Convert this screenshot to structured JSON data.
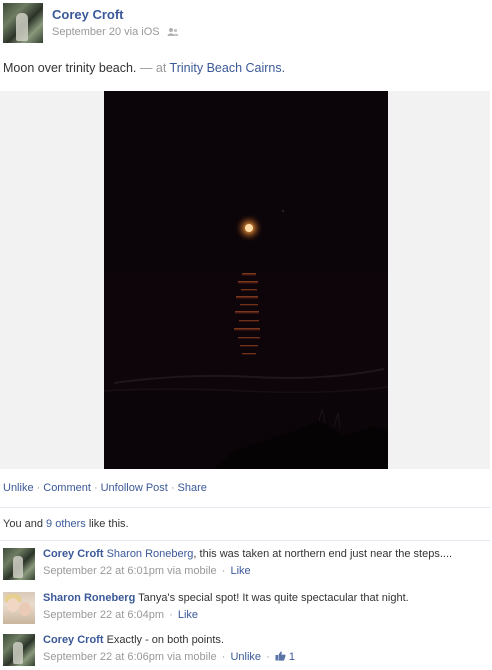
{
  "post": {
    "author": "Corey Croft",
    "date": "September 20",
    "via": "via iOS",
    "privacy_icon": "friends-icon",
    "message": "Moon over trinity beach.",
    "at_prefix": "— at",
    "location": "Trinity Beach Cairns."
  },
  "actions": {
    "unlike": "Unlike",
    "comment": "Comment",
    "unfollow": "Unfollow Post",
    "share": "Share"
  },
  "likes": {
    "prefix": "You and",
    "others_link": "9 others",
    "suffix": "like this."
  },
  "comments": [
    {
      "author": "Corey Croft",
      "text_mention": "Sharon Roneberg",
      "text": ", this was taken at northern end just near the steps....",
      "time": "September 22 at 6:01pm",
      "via": "via mobile",
      "action": "Like"
    },
    {
      "author": "Sharon Roneberg",
      "text": "Tanya's special spot! It was quite spectacular that night.",
      "time": "September 22 at 6:04pm",
      "action": "Like"
    },
    {
      "author": "Corey Croft",
      "text": "Exactly - on both points.",
      "time": "September 22 at 6:06pm",
      "via": "via mobile",
      "action": "Unlike",
      "like_count": "1",
      "like_icon": "thumbs-up-icon"
    }
  ],
  "colors": {
    "link": "#3b5998",
    "muted": "#999999",
    "photo_bg": "#0b0408",
    "moon": "#ffd9a0"
  }
}
